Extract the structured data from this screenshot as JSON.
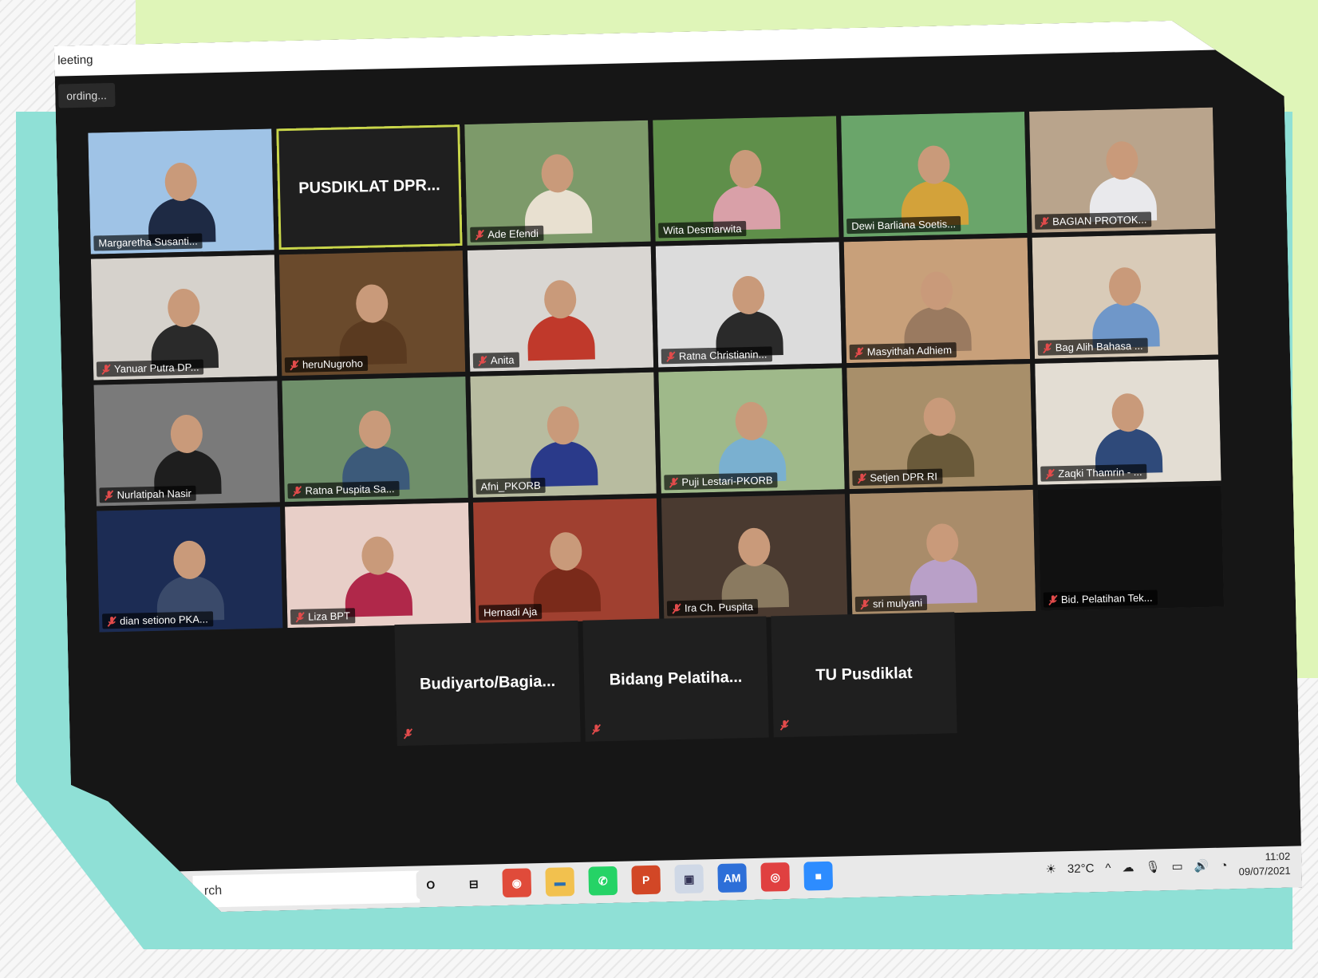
{
  "window": {
    "title": "leeting",
    "recording_label": "ording..."
  },
  "grid": {
    "rows": [
      [
        {
          "name": "Margaretha Susanti...",
          "muted": false,
          "bg": "#9fc3e6",
          "shirt": "#1e2a44"
        },
        {
          "name": "PUSDIKLAT DPR...",
          "namecard": true,
          "speaking": true
        },
        {
          "name": "Ade Efendi",
          "muted": true,
          "bg": "#7d9a6a",
          "shirt": "#e8e0d0"
        },
        {
          "name": "Wita Desmarwita",
          "muted": false,
          "bg": "#5f8f4a",
          "shirt": "#d9a0a8"
        },
        {
          "name": "Dewi Barliana Soetis...",
          "muted": false,
          "bg": "#6aa56a",
          "shirt": "#d3a23a"
        },
        {
          "name": "BAGIAN PROTOK...",
          "muted": true,
          "bg": "#b9a48c",
          "shirt": "#e9e9ec"
        }
      ],
      [
        {
          "name": "Yanuar Putra DP...",
          "muted": true,
          "bg": "#d6d2cc",
          "shirt": "#2a2a2a"
        },
        {
          "name": "heruNugroho",
          "muted": true,
          "bg": "#6a4a2c",
          "shirt": "#5a3a20"
        },
        {
          "name": "Anita",
          "muted": true,
          "bg": "#d9d6d2",
          "shirt": "#c0392b"
        },
        {
          "name": "Ratna Christianin...",
          "muted": true,
          "bg": "#dcdcdc",
          "shirt": "#2a2a2a"
        },
        {
          "name": "Masyithah Adhiem",
          "muted": true,
          "bg": "#c8a07a",
          "shirt": "#9a7a60"
        },
        {
          "name": "Bag Alih Bahasa ...",
          "muted": true,
          "bg": "#d9cbb8",
          "shirt": "#6f97c9"
        }
      ],
      [
        {
          "name": "Nurlatipah Nasir",
          "muted": true,
          "bg": "#7a7a7a",
          "shirt": "#1e1e1e"
        },
        {
          "name": "Ratna Puspita Sa...",
          "muted": true,
          "bg": "#6f8f6a",
          "shirt": "#3c5a7a"
        },
        {
          "name": "Afni_PKORB",
          "muted": false,
          "bg": "#b8bca0",
          "shirt": "#2a3a8a"
        },
        {
          "name": "Puji Lestari-PKORB",
          "muted": true,
          "bg": "#9fb98a",
          "shirt": "#7ab0d0"
        },
        {
          "name": "Setjen DPR RI",
          "muted": true,
          "bg": "#a88f6a",
          "shirt": "#6a5a3a"
        },
        {
          "name": "Zaqki Thamrin - ...",
          "muted": true,
          "bg": "#e3ddd3",
          "shirt": "#2f4a7a"
        }
      ],
      [
        {
          "name": "dian setiono PKA...",
          "muted": true,
          "bg": "#1c2c54",
          "shirt": "#3a4a6a"
        },
        {
          "name": "Liza BPT",
          "muted": true,
          "bg": "#e8cfc8",
          "shirt": "#b0284a"
        },
        {
          "name": "Hernadi Aja",
          "muted": false,
          "bg": "#a04030",
          "shirt": "#7a2a1a"
        },
        {
          "name": "Ira Ch. Puspita",
          "muted": true,
          "bg": "#4a3a30",
          "shirt": "#8a7a60"
        },
        {
          "name": "sri mulyani",
          "muted": true,
          "bg": "#a98c6a",
          "shirt": "#b9a0c8"
        },
        {
          "name": "Bid. Pelatihan Tek...",
          "muted": true,
          "bg": "#111111",
          "shirt": "#111111",
          "blank": true
        }
      ]
    ],
    "bottom": [
      {
        "name": "Budiyarto/Bagia...",
        "muted": true
      },
      {
        "name": "Bidang Pelatiha...",
        "muted": true
      },
      {
        "name": "TU Pusdiklat",
        "muted": true
      }
    ]
  },
  "taskbar": {
    "search_text": "rch",
    "apps": [
      {
        "icon": "cortana-icon",
        "label": "O",
        "color": "#e9e9e9",
        "fg": "#111"
      },
      {
        "icon": "task-view-icon",
        "label": "⊟",
        "color": "#e9e9e9",
        "fg": "#111"
      },
      {
        "icon": "chrome-icon",
        "label": "◉",
        "color": "#e04b3a",
        "fg": "#fff"
      },
      {
        "icon": "file-explorer-icon",
        "label": "▬",
        "color": "#f2c14e",
        "fg": "#2a6fb0"
      },
      {
        "icon": "whatsapp-icon",
        "label": "✆",
        "color": "#25d366",
        "fg": "#fff"
      },
      {
        "icon": "powerpoint-icon",
        "label": "P",
        "color": "#d24726",
        "fg": "#fff"
      },
      {
        "icon": "screen-icon",
        "label": "▣",
        "color": "#cfd8e6",
        "fg": "#335"
      },
      {
        "icon": "am-icon",
        "label": "AM",
        "color": "#2d6fd8",
        "fg": "#fff"
      },
      {
        "icon": "camera-app-icon",
        "label": "◎",
        "color": "#e04040",
        "fg": "#fff"
      },
      {
        "icon": "zoom-icon",
        "label": "■",
        "color": "#2d8cff",
        "fg": "#fff"
      }
    ],
    "weather": "32°C",
    "time": "11:02",
    "date": "09/07/2021"
  }
}
